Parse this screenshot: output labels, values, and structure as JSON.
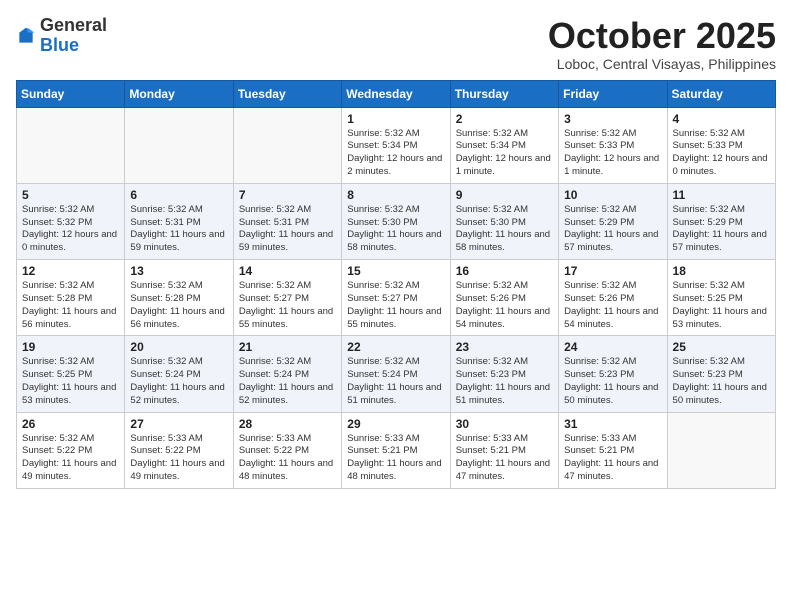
{
  "header": {
    "logo_general": "General",
    "logo_blue": "Blue",
    "month": "October 2025",
    "location": "Loboc, Central Visayas, Philippines"
  },
  "days": [
    "Sunday",
    "Monday",
    "Tuesday",
    "Wednesday",
    "Thursday",
    "Friday",
    "Saturday"
  ],
  "weeks": [
    [
      {
        "date": "",
        "info": ""
      },
      {
        "date": "",
        "info": ""
      },
      {
        "date": "",
        "info": ""
      },
      {
        "date": "1",
        "info": "Sunrise: 5:32 AM\nSunset: 5:34 PM\nDaylight: 12 hours and 2 minutes."
      },
      {
        "date": "2",
        "info": "Sunrise: 5:32 AM\nSunset: 5:34 PM\nDaylight: 12 hours and 1 minute."
      },
      {
        "date": "3",
        "info": "Sunrise: 5:32 AM\nSunset: 5:33 PM\nDaylight: 12 hours and 1 minute."
      },
      {
        "date": "4",
        "info": "Sunrise: 5:32 AM\nSunset: 5:33 PM\nDaylight: 12 hours and 0 minutes."
      }
    ],
    [
      {
        "date": "5",
        "info": "Sunrise: 5:32 AM\nSunset: 5:32 PM\nDaylight: 12 hours and 0 minutes."
      },
      {
        "date": "6",
        "info": "Sunrise: 5:32 AM\nSunset: 5:31 PM\nDaylight: 11 hours and 59 minutes."
      },
      {
        "date": "7",
        "info": "Sunrise: 5:32 AM\nSunset: 5:31 PM\nDaylight: 11 hours and 59 minutes."
      },
      {
        "date": "8",
        "info": "Sunrise: 5:32 AM\nSunset: 5:30 PM\nDaylight: 11 hours and 58 minutes."
      },
      {
        "date": "9",
        "info": "Sunrise: 5:32 AM\nSunset: 5:30 PM\nDaylight: 11 hours and 58 minutes."
      },
      {
        "date": "10",
        "info": "Sunrise: 5:32 AM\nSunset: 5:29 PM\nDaylight: 11 hours and 57 minutes."
      },
      {
        "date": "11",
        "info": "Sunrise: 5:32 AM\nSunset: 5:29 PM\nDaylight: 11 hours and 57 minutes."
      }
    ],
    [
      {
        "date": "12",
        "info": "Sunrise: 5:32 AM\nSunset: 5:28 PM\nDaylight: 11 hours and 56 minutes."
      },
      {
        "date": "13",
        "info": "Sunrise: 5:32 AM\nSunset: 5:28 PM\nDaylight: 11 hours and 56 minutes."
      },
      {
        "date": "14",
        "info": "Sunrise: 5:32 AM\nSunset: 5:27 PM\nDaylight: 11 hours and 55 minutes."
      },
      {
        "date": "15",
        "info": "Sunrise: 5:32 AM\nSunset: 5:27 PM\nDaylight: 11 hours and 55 minutes."
      },
      {
        "date": "16",
        "info": "Sunrise: 5:32 AM\nSunset: 5:26 PM\nDaylight: 11 hours and 54 minutes."
      },
      {
        "date": "17",
        "info": "Sunrise: 5:32 AM\nSunset: 5:26 PM\nDaylight: 11 hours and 54 minutes."
      },
      {
        "date": "18",
        "info": "Sunrise: 5:32 AM\nSunset: 5:25 PM\nDaylight: 11 hours and 53 minutes."
      }
    ],
    [
      {
        "date": "19",
        "info": "Sunrise: 5:32 AM\nSunset: 5:25 PM\nDaylight: 11 hours and 53 minutes."
      },
      {
        "date": "20",
        "info": "Sunrise: 5:32 AM\nSunset: 5:24 PM\nDaylight: 11 hours and 52 minutes."
      },
      {
        "date": "21",
        "info": "Sunrise: 5:32 AM\nSunset: 5:24 PM\nDaylight: 11 hours and 52 minutes."
      },
      {
        "date": "22",
        "info": "Sunrise: 5:32 AM\nSunset: 5:24 PM\nDaylight: 11 hours and 51 minutes."
      },
      {
        "date": "23",
        "info": "Sunrise: 5:32 AM\nSunset: 5:23 PM\nDaylight: 11 hours and 51 minutes."
      },
      {
        "date": "24",
        "info": "Sunrise: 5:32 AM\nSunset: 5:23 PM\nDaylight: 11 hours and 50 minutes."
      },
      {
        "date": "25",
        "info": "Sunrise: 5:32 AM\nSunset: 5:23 PM\nDaylight: 11 hours and 50 minutes."
      }
    ],
    [
      {
        "date": "26",
        "info": "Sunrise: 5:32 AM\nSunset: 5:22 PM\nDaylight: 11 hours and 49 minutes."
      },
      {
        "date": "27",
        "info": "Sunrise: 5:33 AM\nSunset: 5:22 PM\nDaylight: 11 hours and 49 minutes."
      },
      {
        "date": "28",
        "info": "Sunrise: 5:33 AM\nSunset: 5:22 PM\nDaylight: 11 hours and 48 minutes."
      },
      {
        "date": "29",
        "info": "Sunrise: 5:33 AM\nSunset: 5:21 PM\nDaylight: 11 hours and 48 minutes."
      },
      {
        "date": "30",
        "info": "Sunrise: 5:33 AM\nSunset: 5:21 PM\nDaylight: 11 hours and 47 minutes."
      },
      {
        "date": "31",
        "info": "Sunrise: 5:33 AM\nSunset: 5:21 PM\nDaylight: 11 hours and 47 minutes."
      },
      {
        "date": "",
        "info": ""
      }
    ]
  ]
}
